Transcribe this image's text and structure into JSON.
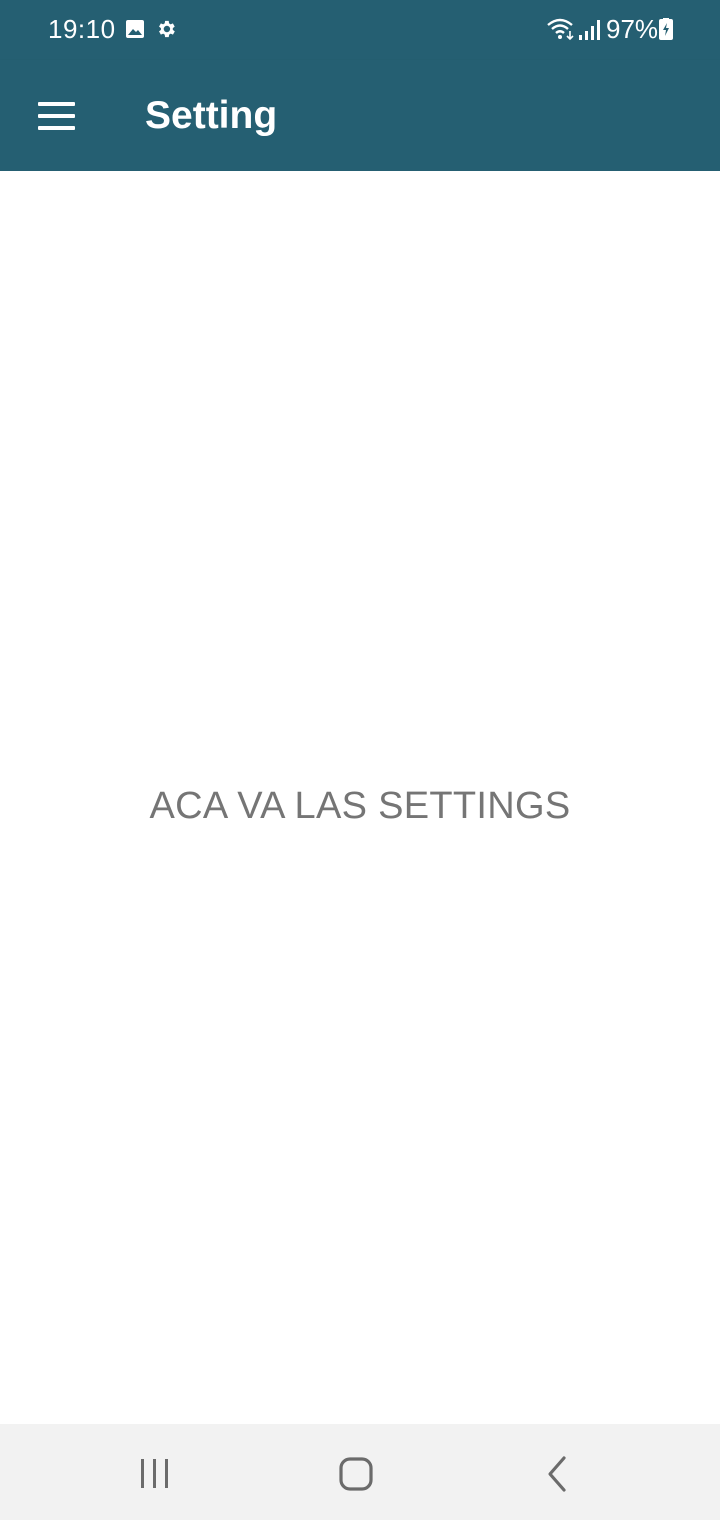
{
  "status_bar": {
    "time": "19:10",
    "battery": "97%",
    "icons": [
      "image-icon",
      "gear-icon",
      "wifi-icon",
      "signal-icon",
      "battery-charging-icon"
    ]
  },
  "app_bar": {
    "title": "Setting",
    "menu_icon": "hamburger-menu-icon"
  },
  "content": {
    "message": "ACA VA LAS SETTINGS"
  },
  "nav_bar": {
    "icons": [
      "recent-apps-icon",
      "home-icon",
      "back-icon"
    ]
  },
  "colors": {
    "primary": "#255f72",
    "text_muted": "#757575",
    "nav_background": "#f2f2f2"
  }
}
